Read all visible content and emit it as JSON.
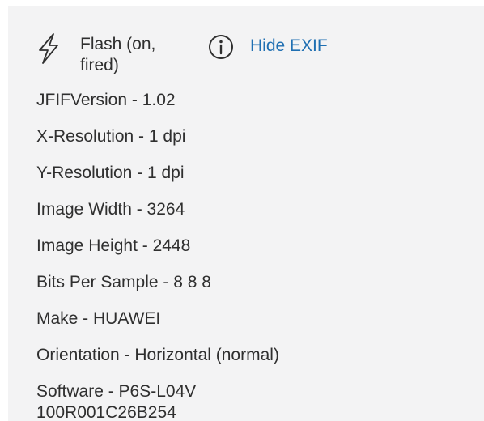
{
  "flash": {
    "icon": "flash-icon",
    "text": "Flash (on, fired)"
  },
  "info": {
    "icon": "info-icon"
  },
  "toggle_exif_label": "Hide EXIF",
  "exif_items": [
    "JFIFVersion - 1.02",
    "X-Resolution - 1 dpi",
    "Y-Resolution - 1 dpi",
    "Image Width - 3264",
    "Image Height - 2448",
    "Bits Per Sample - 8 8 8",
    "Make - HUAWEI",
    "Orientation - Horizontal (normal)",
    "Software - P6S-L04V100R001C26B254"
  ],
  "colors": {
    "panel_bg": "#f3f3f4",
    "text": "#2f2f2f",
    "link": "#1f6fb2"
  }
}
